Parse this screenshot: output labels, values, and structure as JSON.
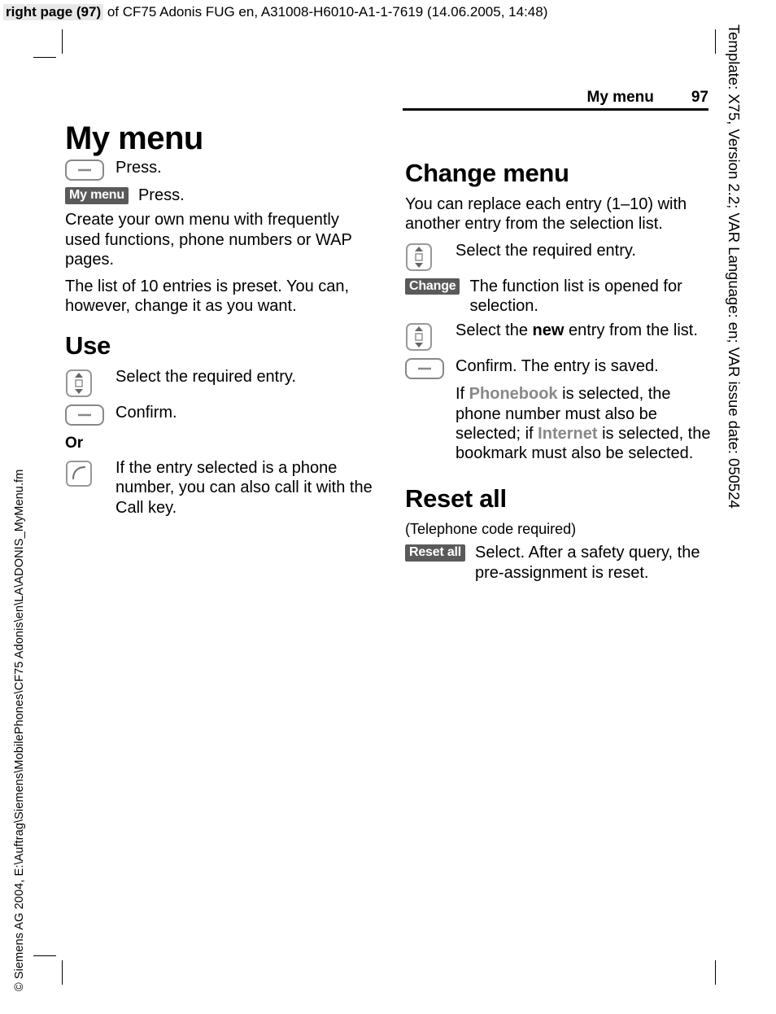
{
  "meta_top": {
    "tag": "right page (97)",
    "rest": " of CF75 Adonis FUG en, A31008-H6010-A1-1-7619 (14.06.2005, 14:48)"
  },
  "side_left": "© Siemens AG 2004, E:\\Auftrag\\Siemens\\MobilePhones\\CF75 Adonis\\en\\LA\\ADONIS_MyMenu.fm",
  "side_right": "Template: X75, Version 2.2; VAR Language: en; VAR issue date: 050524",
  "running": {
    "title": "My menu",
    "page": "97"
  },
  "left": {
    "h1": "My menu",
    "step_press_1": "Press.",
    "softkey_mymenu": "My menu",
    "step_press_2": "Press.",
    "intro_p": "Create your own menu with frequently used functions, phone numbers or WAP pages.",
    "intro_p2": "The list of 10 entries is preset. You can, however, change it as you want.",
    "use_h2": "Use",
    "use_select": "Select the required entry.",
    "use_confirm": "Confirm.",
    "or_label": "Or",
    "use_call": "If the entry selected is a phone number, you can also call it with the Call key."
  },
  "right": {
    "change_h2": "Change menu",
    "change_intro": "You can replace each entry (1–10) with another entry from the selection list.",
    "change_select": "Select the required entry.",
    "softkey_change": "Change",
    "change_open": "The function list is opened for selection.",
    "change_new_pre": "Select the ",
    "change_new_bold": "new",
    "change_new_post": " entry from the list.",
    "change_confirm": "Confirm. The entry is saved.",
    "change_note_pre": "If ",
    "change_note_pb": "Phonebook",
    "change_note_mid": " is selected, the phone number must also be selected; if ",
    "change_note_net": "Internet",
    "change_note_post": " is selected, the bookmark must also be selected.",
    "reset_h2": "Reset all",
    "reset_sub": "(Telephone code required)",
    "softkey_reset": "Reset all",
    "reset_text": "Select. After a safety query, the pre-assignment is reset."
  }
}
